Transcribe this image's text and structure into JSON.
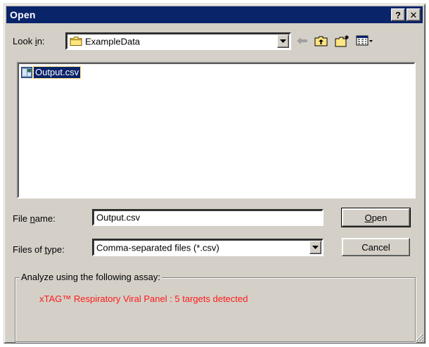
{
  "dialog": {
    "title": "Open",
    "help_button": "?",
    "close_button": "✕"
  },
  "lookin": {
    "label_pre": "Look ",
    "label_underline": "i",
    "label_post": "n:",
    "folder": "ExampleData"
  },
  "toolbar": {
    "icons": [
      "back-arrow-icon",
      "up-one-level-icon",
      "create-new-folder-icon",
      "view-menu-icon"
    ]
  },
  "files": [
    {
      "name": "Output.csv",
      "icon": "csv-file-icon",
      "selected": true
    }
  ],
  "filename": {
    "label_pre": "File ",
    "label_underline": "n",
    "label_post": "ame:",
    "value": "Output.csv"
  },
  "filetype": {
    "label_pre": "Files of ",
    "label_underline": "t",
    "label_post": "ype:",
    "value": "Comma-separated files (*.csv)"
  },
  "buttons": {
    "open_underline": "O",
    "open_rest": "pen",
    "cancel": "Cancel"
  },
  "assay": {
    "legend": "Analyze using the following assay:",
    "text": "xTAG™ Respiratory Viral Panel : 5 targets detected",
    "text_color": "#ff1a1a"
  },
  "colors": {
    "titlebar": "#0a246a",
    "face": "#d4d0c8",
    "selection": "#0a246a"
  }
}
